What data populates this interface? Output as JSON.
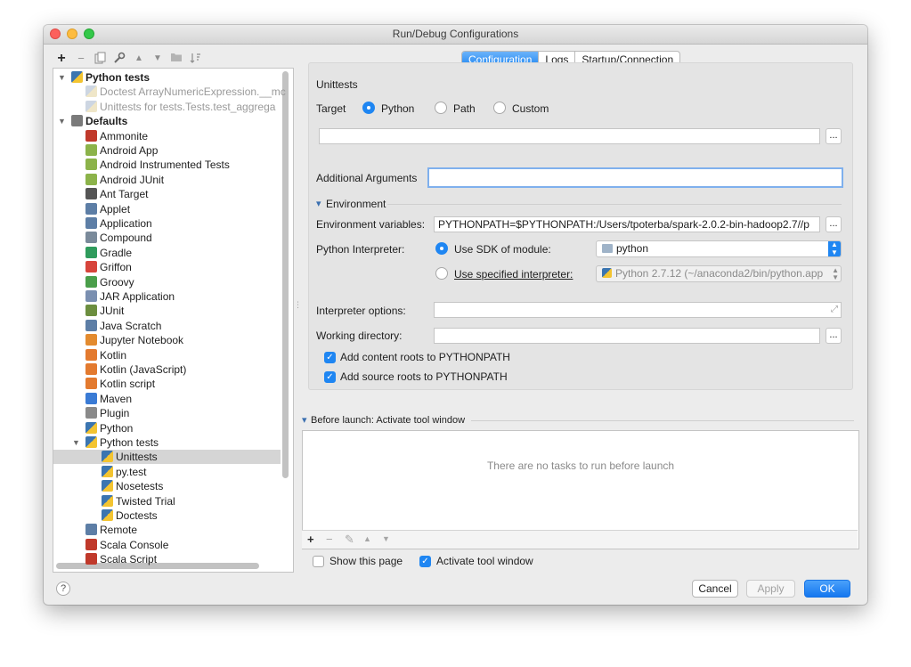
{
  "window": {
    "title": "Run/Debug Configurations"
  },
  "tree": {
    "items": [
      {
        "label": "Python tests",
        "bold": true,
        "level": 0,
        "expanded": true,
        "icon": "python-tests-icon",
        "color": "#3b75b0"
      },
      {
        "label": "Doctest ArrayNumericExpression.__mc",
        "dim": true,
        "level": 1,
        "icon": "python-icon",
        "color": "#d0d6df"
      },
      {
        "label": "Unittests for tests.Tests.test_aggrega",
        "dim": true,
        "level": 1,
        "icon": "python-icon",
        "color": "#d0d6df"
      },
      {
        "label": "Defaults",
        "bold": true,
        "level": 0,
        "expanded": true,
        "icon": "wrench-icon",
        "color": "#7a7a7a"
      },
      {
        "label": "Ammonite",
        "level": 1,
        "icon": "ammonite-icon",
        "color": "#c0392b"
      },
      {
        "label": "Android App",
        "level": 1,
        "icon": "android-icon",
        "color": "#8cb34a"
      },
      {
        "label": "Android Instrumented Tests",
        "level": 1,
        "icon": "android-icon",
        "color": "#8cb34a"
      },
      {
        "label": "Android JUnit",
        "level": 1,
        "icon": "android-icon",
        "color": "#8cb34a"
      },
      {
        "label": "Ant Target",
        "level": 1,
        "icon": "ant-icon",
        "color": "#555555"
      },
      {
        "label": "Applet",
        "level": 1,
        "icon": "applet-icon",
        "color": "#5d7ea6"
      },
      {
        "label": "Application",
        "level": 1,
        "icon": "application-icon",
        "color": "#5d7ea6"
      },
      {
        "label": "Compound",
        "level": 1,
        "icon": "compound-icon",
        "color": "#7a8a9a"
      },
      {
        "label": "Gradle",
        "level": 1,
        "icon": "gradle-icon",
        "color": "#2f9b5c"
      },
      {
        "label": "Griffon",
        "level": 1,
        "icon": "griffon-icon",
        "color": "#d7443b"
      },
      {
        "label": "Groovy",
        "level": 1,
        "icon": "groovy-icon",
        "color": "#4a9e4a"
      },
      {
        "label": "JAR Application",
        "level": 1,
        "icon": "jar-icon",
        "color": "#7a8fb0"
      },
      {
        "label": "JUnit",
        "level": 1,
        "icon": "junit-icon",
        "color": "#6c8e3f"
      },
      {
        "label": "Java Scratch",
        "level": 1,
        "icon": "java-scratch-icon",
        "color": "#5d7ea6"
      },
      {
        "label": "Jupyter Notebook",
        "level": 1,
        "icon": "jupyter-icon",
        "color": "#e38b2f"
      },
      {
        "label": "Kotlin",
        "level": 1,
        "icon": "kotlin-icon",
        "color": "#e37a2f"
      },
      {
        "label": "Kotlin (JavaScript)",
        "level": 1,
        "icon": "kotlin-icon",
        "color": "#e37a2f"
      },
      {
        "label": "Kotlin script",
        "level": 1,
        "icon": "kotlin-icon",
        "color": "#e37a2f"
      },
      {
        "label": "Maven",
        "level": 1,
        "icon": "maven-icon",
        "color": "#3a7bd5"
      },
      {
        "label": "Plugin",
        "level": 1,
        "icon": "plugin-icon",
        "color": "#8a8a8a"
      },
      {
        "label": "Python",
        "level": 1,
        "icon": "python-icon",
        "color": "#3b75b0"
      },
      {
        "label": "Python tests",
        "level": 1,
        "expanded": true,
        "icon": "python-tests-icon",
        "color": "#3b75b0"
      },
      {
        "label": "Unittests",
        "level": 2,
        "selected": true,
        "icon": "python-icon",
        "color": "#3b75b0"
      },
      {
        "label": "py.test",
        "level": 2,
        "icon": "python-icon",
        "color": "#3b75b0"
      },
      {
        "label": "Nosetests",
        "level": 2,
        "icon": "python-icon",
        "color": "#3b75b0"
      },
      {
        "label": "Twisted Trial",
        "level": 2,
        "icon": "python-icon",
        "color": "#3b75b0"
      },
      {
        "label": "Doctests",
        "level": 2,
        "icon": "python-icon",
        "color": "#3b75b0"
      },
      {
        "label": "Remote",
        "level": 1,
        "icon": "remote-icon",
        "color": "#5d7ea6"
      },
      {
        "label": "Scala Console",
        "level": 1,
        "icon": "scala-console-icon",
        "color": "#c0392b"
      },
      {
        "label": "Scala Script",
        "level": 1,
        "icon": "scala-script-icon",
        "color": "#c0392b"
      }
    ]
  },
  "tabs": [
    {
      "label": "Configuration",
      "active": true
    },
    {
      "label": "Logs",
      "active": false
    },
    {
      "label": "Startup/Connection",
      "active": false
    }
  ],
  "config": {
    "section_title": "Unittests",
    "target_label": "Target",
    "target_options": {
      "python": "Python",
      "path": "Path",
      "custom": "Custom"
    },
    "target_value": "",
    "dots": "...",
    "additional_args_label": "Additional Arguments",
    "additional_args_value": "",
    "environment_section": "Environment",
    "env_vars_label": "Environment variables:",
    "env_vars_value": "PYTHONPATH=$PYTHONPATH:/Users/tpoterba/spark-2.0.2-bin-hadoop2.7//p",
    "interpreter_label": "Python Interpreter:",
    "use_sdk_label": "Use SDK of module:",
    "sdk_module_value": "python",
    "use_specified_label": "Use specified interpreter:",
    "specified_interpreter_value": "Python 2.7.12 (~/anaconda2/bin/python.app",
    "interpreter_options_label": "Interpreter options:",
    "working_dir_label": "Working directory:",
    "add_content_roots_label": "Add content roots to PYTHONPATH",
    "add_source_roots_label": "Add source roots to PYTHONPATH"
  },
  "before_launch": {
    "title": "Before launch: Activate tool window",
    "empty_text": "There are no tasks to run before launch"
  },
  "footer": {
    "show_page_label": "Show this page",
    "activate_tool_label": "Activate tool window",
    "cancel": "Cancel",
    "apply": "Apply",
    "ok": "OK",
    "help": "?"
  }
}
